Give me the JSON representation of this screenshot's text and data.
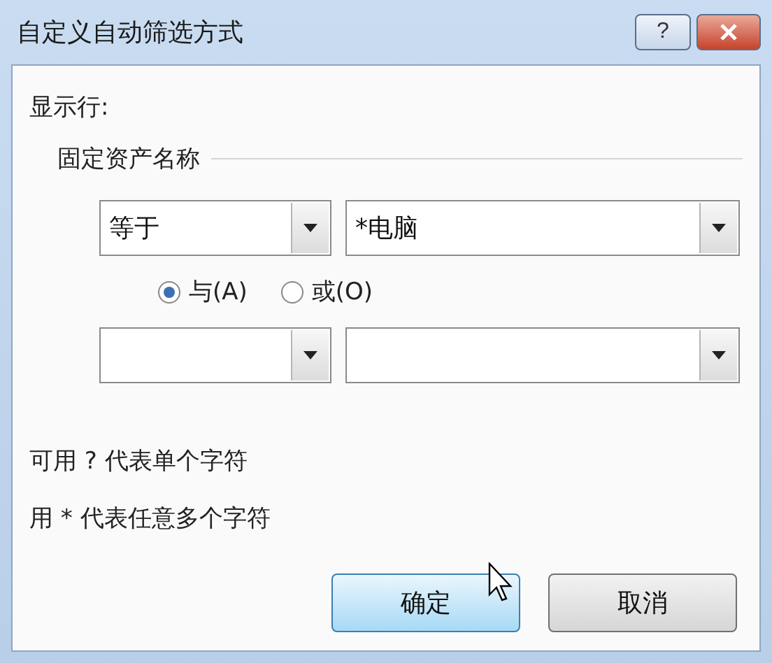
{
  "window": {
    "title": "自定义自动筛选方式",
    "help_button": "?"
  },
  "show_rows_label": "显示行:",
  "group": {
    "label": "固定资产名称"
  },
  "criteria": [
    {
      "kind": "filled",
      "operator": "等于",
      "value": "*电脑"
    },
    {
      "kind": "blank"
    }
  ],
  "logic": [
    {
      "label": "与(A)",
      "selected": true
    },
    {
      "label": "或(O)",
      "selected": false
    }
  ],
  "hints": [
    "可用 ? 代表单个字符",
    "用 * 代表任意多个字符"
  ],
  "buttons": [
    {
      "label": "确定",
      "default": true
    },
    {
      "label": "取消",
      "default": false
    }
  ]
}
